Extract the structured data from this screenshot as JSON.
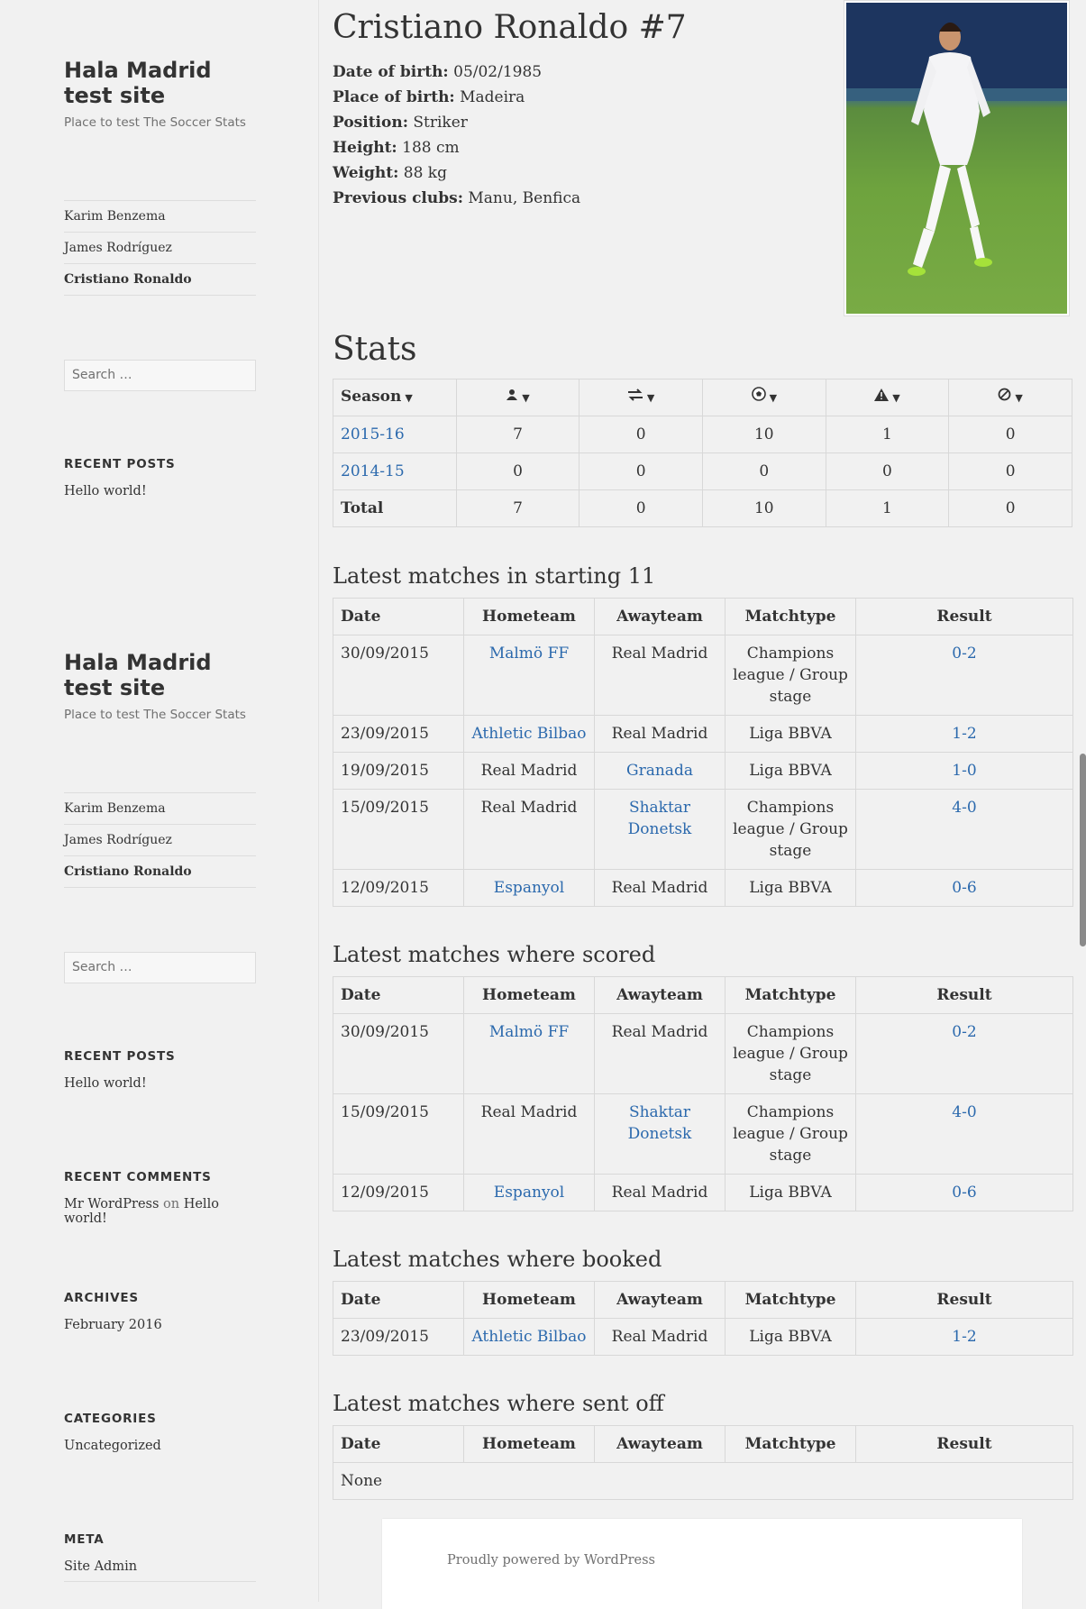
{
  "sidebar": {
    "blocks": [
      {
        "site_title": "Hala Madrid test site",
        "site_desc": "Place to test The Soccer Stats",
        "nav": [
          "Karim Benzema",
          "James Rodríguez",
          "Cristiano Ronaldo"
        ],
        "search_placeholder": "Search …",
        "recent_posts_title": "RECENT POSTS",
        "recent_post": "Hello world!"
      },
      {
        "site_title": "Hala Madrid test site",
        "site_desc": "Place to test The Soccer Stats",
        "nav": [
          "Karim Benzema",
          "James Rodríguez",
          "Cristiano Ronaldo"
        ],
        "search_placeholder": "Search …",
        "recent_posts_title": "RECENT POSTS",
        "recent_post": "Hello world!"
      }
    ],
    "recent_comments": {
      "title": "RECENT COMMENTS",
      "author": "Mr WordPress",
      "on": "on",
      "post": "Hello world!"
    },
    "archives": {
      "title": "ARCHIVES",
      "item": "February 2016"
    },
    "categories": {
      "title": "CATEGORIES",
      "item": "Uncategorized"
    },
    "meta": {
      "title": "META",
      "item": "Site Admin"
    }
  },
  "player": {
    "name": "Cristiano Ronaldo #7",
    "info": [
      {
        "label": "Date of birth:",
        "value": "05/02/1985"
      },
      {
        "label": "Place of birth:",
        "value": "Madeira"
      },
      {
        "label": "Position:",
        "value": "Striker"
      },
      {
        "label": "Height:",
        "value": "188 cm"
      },
      {
        "label": "Weight:",
        "value": "88 kg"
      },
      {
        "label": "Previous clubs:",
        "value": "Manu, Benfica"
      }
    ]
  },
  "stats": {
    "title": "Stats",
    "headers": [
      "Season",
      "",
      "",
      "",
      "",
      ""
    ],
    "header_icons": [
      "",
      "user-icon",
      "exchange-icon",
      "soccer-ball-icon",
      "warning-icon",
      "ban-icon"
    ],
    "rows": [
      {
        "season": "2015-16",
        "link": true,
        "values": [
          "7",
          "0",
          "10",
          "1",
          "0"
        ]
      },
      {
        "season": "2014-15",
        "link": true,
        "values": [
          "0",
          "0",
          "0",
          "0",
          "0"
        ]
      },
      {
        "season": "Total",
        "link": false,
        "values": [
          "7",
          "0",
          "10",
          "1",
          "0"
        ]
      }
    ]
  },
  "match_headers": [
    "Date",
    "Hometeam",
    "Awayteam",
    "Matchtype",
    "Result"
  ],
  "sections": [
    {
      "title": "Latest matches in starting 11",
      "rows": [
        {
          "date": "30/09/2015",
          "home": "Malmö FF",
          "home_link": true,
          "away": "Real Madrid",
          "away_link": false,
          "type": "Champions league / Group stage",
          "result": "0-2"
        },
        {
          "date": "23/09/2015",
          "home": "Athletic Bilbao",
          "home_link": true,
          "away": "Real Madrid",
          "away_link": false,
          "type": "Liga BBVA",
          "result": "1-2"
        },
        {
          "date": "19/09/2015",
          "home": "Real Madrid",
          "home_link": false,
          "away": "Granada",
          "away_link": true,
          "type": "Liga BBVA",
          "result": "1-0"
        },
        {
          "date": "15/09/2015",
          "home": "Real Madrid",
          "home_link": false,
          "away": "Shaktar Donetsk",
          "away_link": true,
          "type": "Champions league / Group stage",
          "result": "4-0"
        },
        {
          "date": "12/09/2015",
          "home": "Espanyol",
          "home_link": true,
          "away": "Real Madrid",
          "away_link": false,
          "type": "Liga BBVA",
          "result": "0-6"
        }
      ]
    },
    {
      "title": "Latest matches where scored",
      "rows": [
        {
          "date": "30/09/2015",
          "home": "Malmö FF",
          "home_link": true,
          "away": "Real Madrid",
          "away_link": false,
          "type": "Champions league / Group stage",
          "result": "0-2"
        },
        {
          "date": "15/09/2015",
          "home": "Real Madrid",
          "home_link": false,
          "away": "Shaktar Donetsk",
          "away_link": true,
          "type": "Champions league / Group stage",
          "result": "4-0"
        },
        {
          "date": "12/09/2015",
          "home": "Espanyol",
          "home_link": true,
          "away": "Real Madrid",
          "away_link": false,
          "type": "Liga BBVA",
          "result": "0-6"
        }
      ]
    },
    {
      "title": "Latest matches where booked",
      "rows": [
        {
          "date": "23/09/2015",
          "home": "Athletic Bilbao",
          "home_link": true,
          "away": "Real Madrid",
          "away_link": false,
          "type": "Liga BBVA",
          "result": "1-2"
        }
      ]
    },
    {
      "title": "Latest matches where sent off",
      "rows": [],
      "empty_text": "None"
    }
  ],
  "footer": {
    "text": "Proudly powered by WordPress"
  }
}
